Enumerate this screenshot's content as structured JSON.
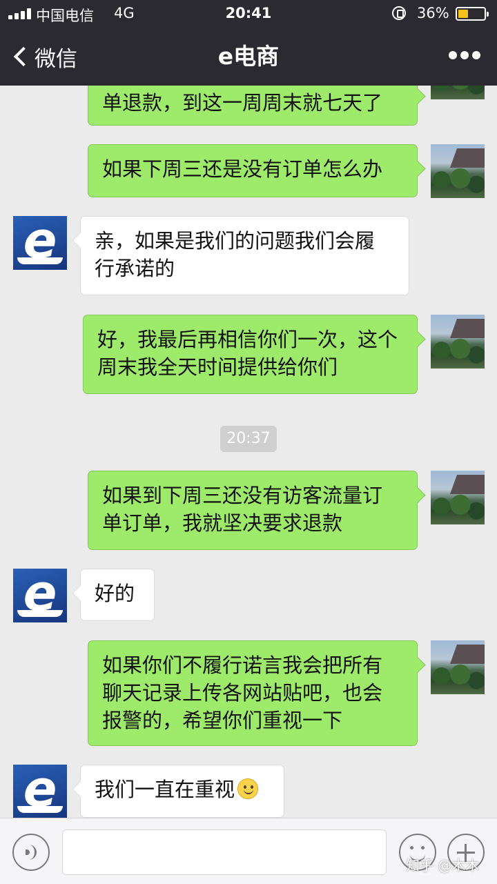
{
  "status_bar": {
    "carrier": "中国电信",
    "network": "4G",
    "time": "20:41",
    "battery_pct": "36%",
    "battery_level": 0.36,
    "icons": [
      "signal-icon",
      "orientation-lock-icon",
      "battery-icon"
    ]
  },
  "nav": {
    "back_label": "微信",
    "title": "e电商",
    "more_icon": "more-dots-icon"
  },
  "messages": [
    {
      "sender": "me",
      "text": "单退款，到这一周周末就七天了"
    },
    {
      "sender": "me",
      "text": "如果下周三还是没有订单怎么办"
    },
    {
      "sender": "other",
      "text": "亲，如果是我们的问题我们会履行承诺的"
    },
    {
      "sender": "me",
      "text": "好，我最后再相信你们一次，这个周末我全天时间提供给你们"
    },
    {
      "sender": "me",
      "text": "如果到下周三还没有访客流量订单订单，我就坚决要求退款"
    },
    {
      "sender": "other",
      "text": "好的"
    },
    {
      "sender": "me",
      "text": "如果你们不履行诺言我会把所有聊天记录上传各网站贴吧，也会报警的，希望你们重视一下"
    },
    {
      "sender": "other",
      "text": "我们一直在重视",
      "emoji": "smile-emoji"
    }
  ],
  "timestamp": "20:37",
  "input_bar": {
    "voice_icon": "voice-icon",
    "emoji_icon": "emoji-icon",
    "plus_icon": "plus-icon"
  },
  "watermark": "知乎 @木木",
  "colors": {
    "header_bg": "#2b2a31",
    "my_bubble": "#9eea6a",
    "their_bubble": "#ffffff",
    "chat_bg": "#ebebeb"
  }
}
